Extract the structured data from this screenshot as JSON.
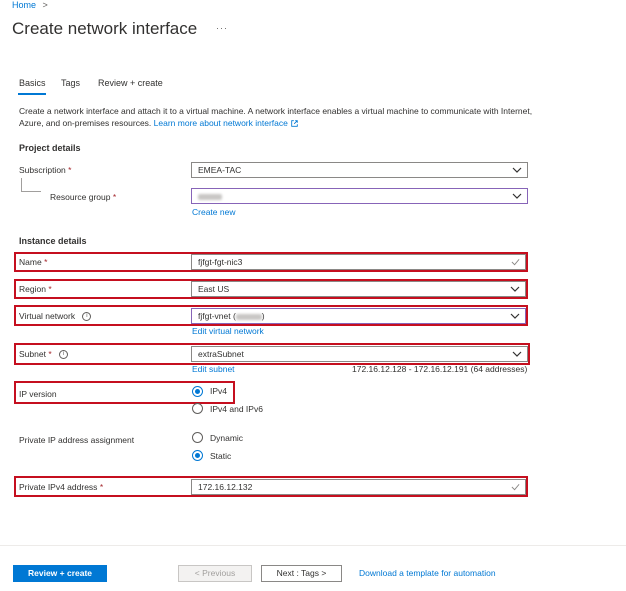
{
  "breadcrumb": {
    "home": "Home",
    "separator": ">"
  },
  "page": {
    "title": "Create network interface",
    "more": "···"
  },
  "tabs": [
    {
      "label": "Basics",
      "active": true
    },
    {
      "label": "Tags",
      "active": false
    },
    {
      "label": "Review + create",
      "active": false
    }
  ],
  "intro": {
    "text": "Create a network interface and attach it to a virtual machine. A network interface enables a virtual machine to communicate with Internet, Azure, and on-premises resources.",
    "learn_more": "Learn more about network interface"
  },
  "project_details": {
    "heading": "Project details",
    "subscription_label": "Subscription",
    "subscription_value": "EMEA-TAC",
    "resource_group_label": "Resource group",
    "create_new": "Create new"
  },
  "instance_details": {
    "heading": "Instance details",
    "name_label": "Name",
    "name_value": "fjfgt-fgt-nic3",
    "region_label": "Region",
    "region_value": "East US",
    "vnet_label": "Virtual network",
    "vnet_value": "fjfgt-vnet (",
    "vnet_value_end": ")",
    "edit_vnet": "Edit virtual network",
    "subnet_label": "Subnet",
    "subnet_value": "extraSubnet",
    "edit_subnet": "Edit subnet",
    "subnet_range": "172.16.12.128 - 172.16.12.191 (64 addresses)",
    "ip_version_label": "IP version",
    "ip_version_options": [
      "IPv4",
      "IPv4 and IPv6"
    ],
    "ip_version_selected": "IPv4",
    "private_ip_assignment_label": "Private IP address assignment",
    "assignment_options": [
      "Dynamic",
      "Static"
    ],
    "assignment_selected": "Static",
    "private_ipv4_label": "Private IPv4 address",
    "private_ipv4_value": "172.16.12.132",
    "required_marker": "*"
  },
  "footer": {
    "review_create": "Review + create",
    "previous": "< Previous",
    "next": "Next : Tags >",
    "download_template": "Download a template for automation"
  },
  "colors": {
    "accent": "#0078d4",
    "highlight": "#c50f1f",
    "active_border": "#8764b8"
  },
  "icons": [
    "chevron-right-icon",
    "more-icon",
    "external-link-icon",
    "chevron-down-icon",
    "checkmark-icon",
    "info-icon"
  ]
}
